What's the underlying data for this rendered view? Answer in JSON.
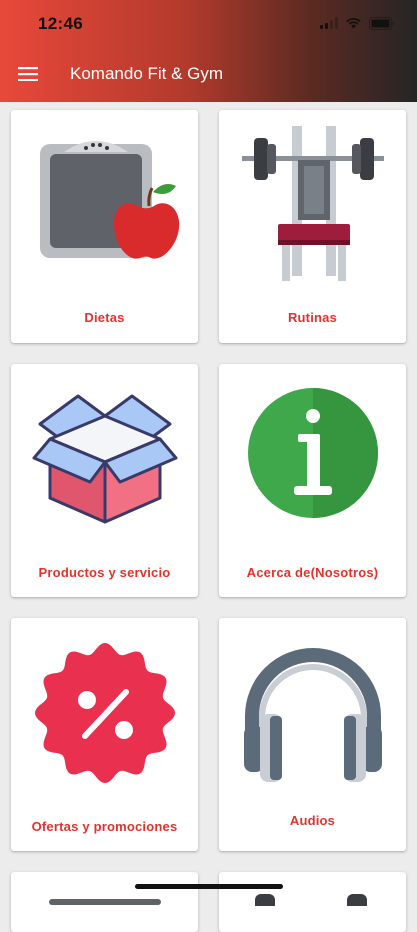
{
  "status_bar": {
    "time": "12:46"
  },
  "appbar": {
    "title": "Komando Fit & Gym"
  },
  "grid": {
    "items": [
      {
        "label": "Dietas",
        "icon": "scale-apple-icon"
      },
      {
        "label": "Rutinas",
        "icon": "weight-bench-icon"
      },
      {
        "label": "Productos y servicio",
        "icon": "open-box-icon"
      },
      {
        "label": "Acerca de(Nosotros)",
        "icon": "info-icon"
      },
      {
        "label": "Ofertas y promociones",
        "icon": "discount-badge-icon"
      },
      {
        "label": "Audios",
        "icon": "headphones-icon"
      }
    ]
  },
  "colors": {
    "accent_text": "#e4322b",
    "appbar_start": "#e8483a",
    "appbar_end": "#252525",
    "background": "#ececec"
  }
}
